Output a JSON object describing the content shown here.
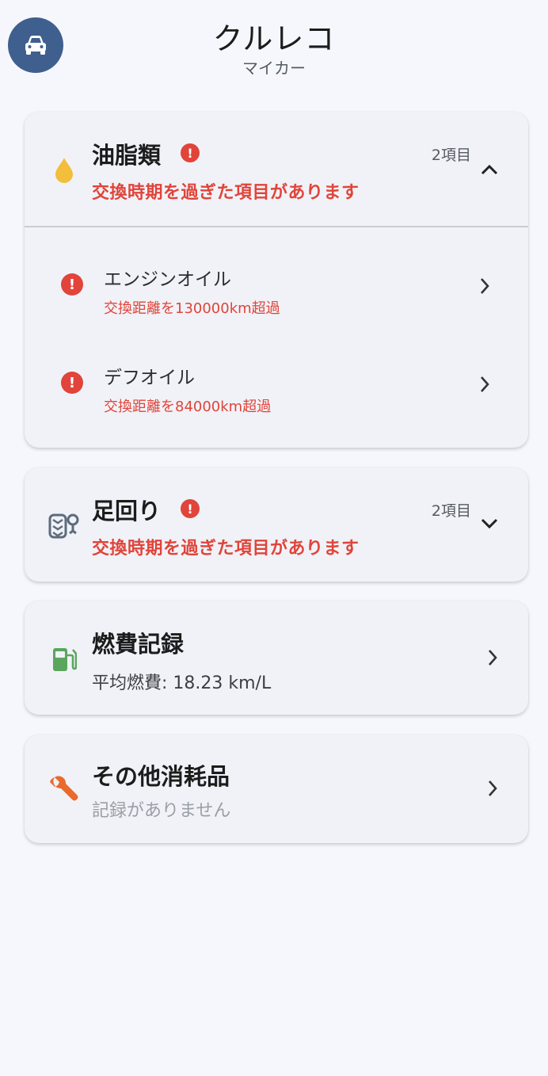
{
  "header": {
    "title": "クルレコ",
    "subtitle": "マイカー",
    "car_icon": "car-icon",
    "accent": "#3f5f8e"
  },
  "categories": [
    {
      "title": "油脂類",
      "count": "2項目",
      "warning": "交換時期を過ぎた項目があります",
      "icon": "oil-drop-icon",
      "expanded": true,
      "items": [
        {
          "name": "エンジンオイル",
          "detail": "交換距離を130000km超過"
        },
        {
          "name": "デフオイル",
          "detail": "交換距離を84000km超過"
        }
      ]
    },
    {
      "title": "足回り",
      "count": "2項目",
      "warning": "交換時期を過ぎた項目があります",
      "icon": "tire-icon",
      "expanded": false
    }
  ],
  "fuel": {
    "title": "燃費記録",
    "summary": "平均燃費: 18.23 km/L",
    "icon": "fuel-pump-icon"
  },
  "others": {
    "title": "その他消耗品",
    "summary": "記録がありません",
    "icon": "wrench-icon"
  },
  "colors": {
    "alert": "#e0443a",
    "oil": "#f2be3b",
    "fuel": "#5aa65c",
    "wrench": "#ea6a2b",
    "tire": "#5b6c7e"
  }
}
